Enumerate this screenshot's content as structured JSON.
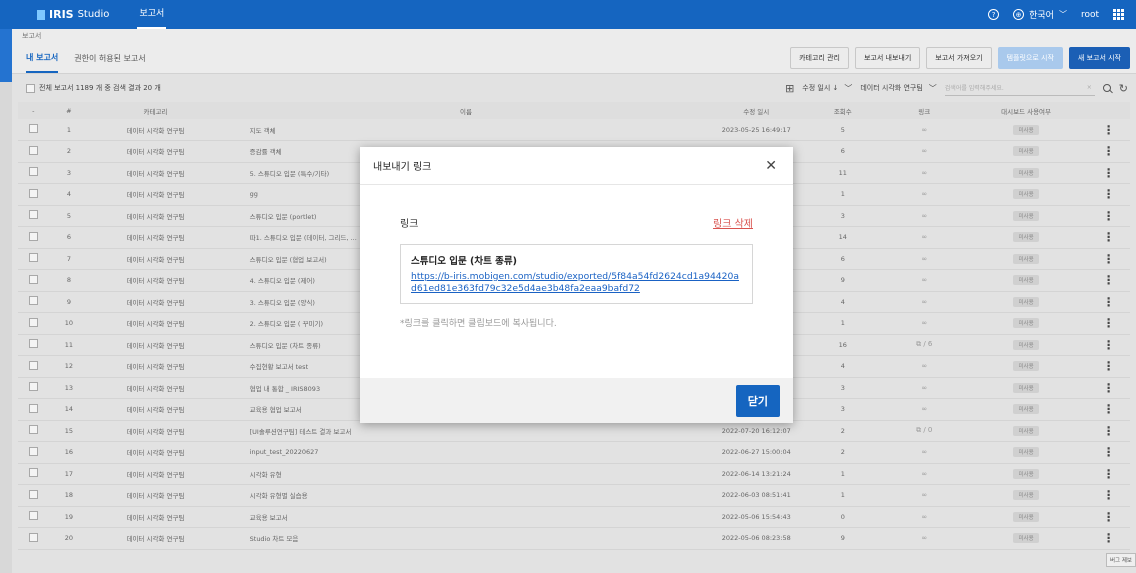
{
  "header": {
    "logo_iris": "IRIS",
    "logo_studio": "Studio",
    "nav_tab": "보고서",
    "help_icon": "?",
    "language": "한국어",
    "user": "root"
  },
  "breadcrumb": "보고서",
  "tabs": [
    "내 보고서",
    "권한이 허용된 보고서"
  ],
  "actions": {
    "category_manage": "카테고리 관리",
    "export_report": "보고서 내보내기",
    "import_report": "보고서 가져오기",
    "template_start": "템플릿으로 시작",
    "new_report": "새 보고서 시작"
  },
  "toolbar": {
    "count_text": "전체 보고서 1189 개 중 검색 결과 20 개",
    "sort_label": "수정 일시 ↓",
    "category_filter": "데이터 시각화 연구팀",
    "search_placeholder": "검색어를 입력해주세요."
  },
  "table": {
    "headers": [
      "-",
      "#",
      "카테고리",
      "이름",
      "수정 일시",
      "조회수",
      "링크",
      "대시보드 사용여부"
    ],
    "rows": [
      {
        "num": "1",
        "category": "데이터 시각화 연구팀",
        "name": "지도 객체",
        "date": "2023-05-25 16:49:17",
        "views": "5",
        "link": "∞",
        "dashboard": "미사용"
      },
      {
        "num": "2",
        "category": "데이터 시각화 연구팀",
        "name": "증감률 객체",
        "date": "",
        "views": "6",
        "link": "∞",
        "dashboard": "미사용"
      },
      {
        "num": "3",
        "category": "데이터 시각화 연구팀",
        "name": "5. 스튜디오 입문 (특수/기타)",
        "date": "",
        "views": "11",
        "link": "∞",
        "dashboard": "미사용"
      },
      {
        "num": "4",
        "category": "데이터 시각화 연구팀",
        "name": "gg",
        "date": "",
        "views": "1",
        "link": "∞",
        "dashboard": "미사용"
      },
      {
        "num": "5",
        "category": "데이터 시각화 연구팀",
        "name": "스튜디오 입문 (portlet)",
        "date": "",
        "views": "3",
        "link": "∞",
        "dashboard": "미사용"
      },
      {
        "num": "6",
        "category": "데이터 시각화 연구팀",
        "name": "따1. 스튜디오 입문 (데이터, 그리드, ...",
        "date": "",
        "views": "14",
        "link": "∞",
        "dashboard": "미사용"
      },
      {
        "num": "7",
        "category": "데이터 시각화 연구팀",
        "name": "스튜디오 입문 (협업 보고서)",
        "date": "",
        "views": "6",
        "link": "∞",
        "dashboard": "미사용"
      },
      {
        "num": "8",
        "category": "데이터 시각화 연구팀",
        "name": "4. 스튜디오 입문 (제어)",
        "date": "",
        "views": "9",
        "link": "∞",
        "dashboard": "미사용"
      },
      {
        "num": "9",
        "category": "데이터 시각화 연구팀",
        "name": "3. 스튜디오 입문 (양식)",
        "date": "",
        "views": "4",
        "link": "∞",
        "dashboard": "미사용"
      },
      {
        "num": "10",
        "category": "데이터 시각화 연구팀",
        "name": "2. 스튜디오 입문 ( 꾸미기)",
        "date": "",
        "views": "1",
        "link": "∞",
        "dashboard": "미사용"
      },
      {
        "num": "11",
        "category": "데이터 시각화 연구팀",
        "name": "스튜디오 입문 (차트 종류)",
        "date": "",
        "views": "16",
        "link": "⧉ / 6",
        "dashboard": "미사용"
      },
      {
        "num": "12",
        "category": "데이터 시각화 연구팀",
        "name": "수집현황 보고서 test",
        "date": "",
        "views": "4",
        "link": "∞",
        "dashboard": "미사용"
      },
      {
        "num": "13",
        "category": "데이터 시각화 연구팀",
        "name": "협업 내 통합 _ IRIS8093",
        "date": "",
        "views": "3",
        "link": "∞",
        "dashboard": "미사용"
      },
      {
        "num": "14",
        "category": "데이터 시각화 연구팀",
        "name": "교육용 협업 보고서",
        "date": "",
        "views": "3",
        "link": "∞",
        "dashboard": "미사용"
      },
      {
        "num": "15",
        "category": "데이터 시각화 연구팀",
        "name": "[UI솔루션연구팀] 테스트 결과 보고서",
        "date": "2022-07-20 16:12:07",
        "views": "2",
        "link": "⧉ / 0",
        "dashboard": "미사용"
      },
      {
        "num": "16",
        "category": "데이터 시각화 연구팀",
        "name": "input_test_20220627",
        "date": "2022-06-27 15:00:04",
        "views": "2",
        "link": "∞",
        "dashboard": "미사용"
      },
      {
        "num": "17",
        "category": "데이터 시각화 연구팀",
        "name": "시각화 유형",
        "date": "2022-06-14 13:21:24",
        "views": "1",
        "link": "∞",
        "dashboard": "미사용"
      },
      {
        "num": "18",
        "category": "데이터 시각화 연구팀",
        "name": "시각화 유형별 실습용",
        "date": "2022-06-03 08:51:41",
        "views": "1",
        "link": "∞",
        "dashboard": "미사용"
      },
      {
        "num": "19",
        "category": "데이터 시각화 연구팀",
        "name": "교육용 보고서",
        "date": "2022-05-06 15:54:43",
        "views": "0",
        "link": "∞",
        "dashboard": "미사용"
      },
      {
        "num": "20",
        "category": "데이터 시각화 연구팀",
        "name": "Studio 차트 모음",
        "date": "2022-05-06 08:23:58",
        "views": "9",
        "link": "∞",
        "dashboard": "미사용"
      }
    ]
  },
  "modal": {
    "title": "내보내기 링크",
    "link_label": "링크",
    "delete_link": "링크 삭제",
    "report_name": "스튜디오 입문 (차트 종류)",
    "url": "https://b-iris.mobigen.com/studio/exported/5f84a54fd2624cd1a94420ad61ed81e363fd79c32e5d4ae3b48fa2eaa9bafd72",
    "hint": "*링크를 클릭하면 클립보드에 복사됩니다.",
    "close_button": "닫기"
  },
  "corner_tag": "버그 제보",
  "colors": {
    "brand": "#1565c0",
    "delete": "#d9534f",
    "link": "#1a62c4"
  }
}
